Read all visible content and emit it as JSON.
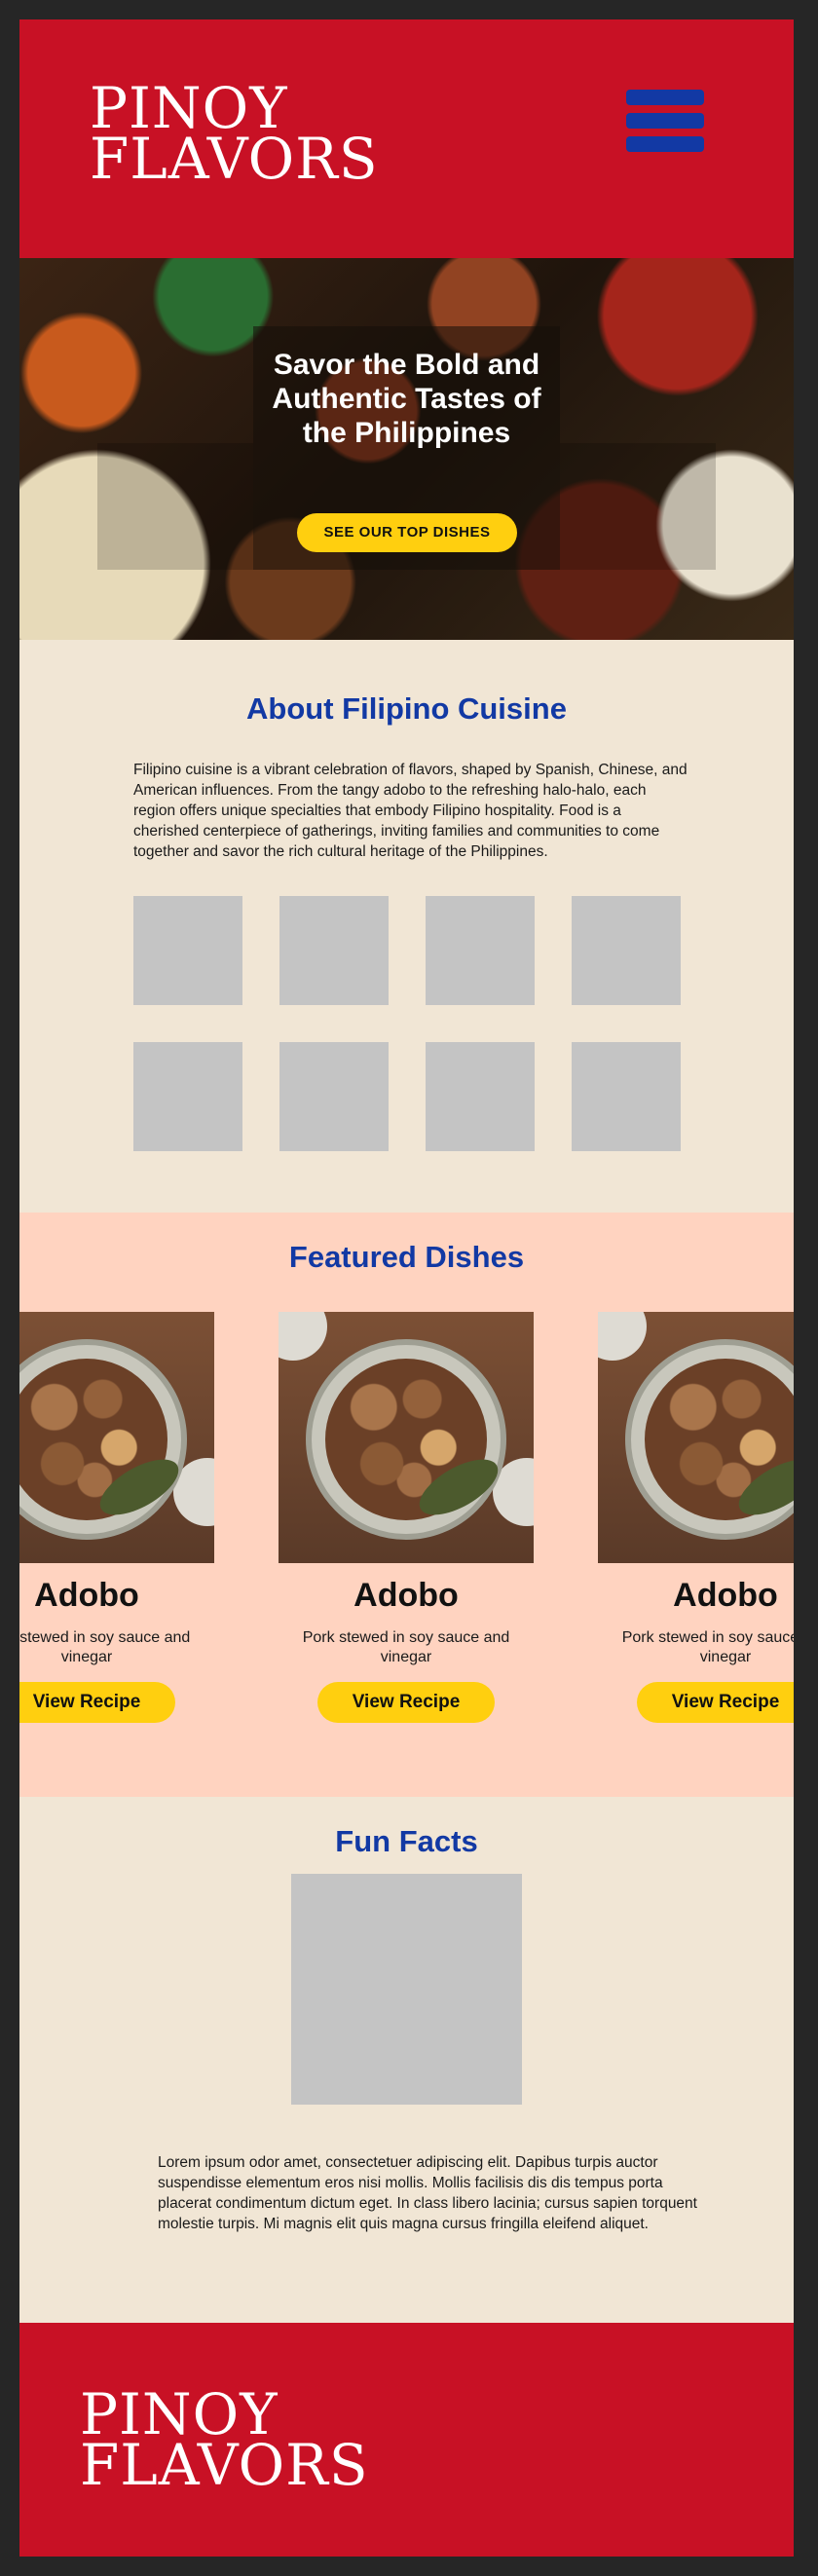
{
  "header": {
    "logo_line1": "PINOY",
    "logo_line2": "FLAVORS",
    "menu_icon": "hamburger-menu-icon"
  },
  "hero": {
    "title": "Savor the Bold and Authentic Tastes of the Philippines",
    "cta_label": "SEE OUR TOP DISHES"
  },
  "about": {
    "title": "About Filipino Cuisine",
    "text": "Filipino cuisine is a vibrant celebration of flavors, shaped by Spanish, Chinese, and American influences. From the tangy adobo to the refreshing halo-halo, each region offers unique specialties that embody Filipino hospitality. Food is a cherished centerpiece of gatherings, inviting families and communities to come together and savor the rich cultural heritage of the Philippines."
  },
  "featured": {
    "title": "Featured Dishes",
    "cards": [
      {
        "name": "Adobo",
        "desc": "Pork stewed in soy sauce and vinegar",
        "button": "View Recipe"
      },
      {
        "name": "Adobo",
        "desc": "Pork stewed in soy sauce and vinegar",
        "button": "View Recipe"
      },
      {
        "name": "Adobo",
        "desc": "Pork stewed in soy sauce and vinegar",
        "button": "View Recipe"
      }
    ]
  },
  "fun_facts": {
    "title": "Fun Facts",
    "text": "Lorem ipsum odor amet, consectetuer adipiscing elit. Dapibus turpis auctor suspendisse elementum eros nisi mollis. Mollis facilisis dis dis tempus porta placerat condimentum dictum eget. In class libero lacinia; cursus sapien torquent molestie turpis. Mi magnis elit quis magna cursus fringilla eleifend aliquet."
  },
  "footer": {
    "logo_line1": "PINOY",
    "logo_line2": "FLAVORS"
  },
  "colors": {
    "brand_red": "#c81125",
    "accent_blue": "#1239a4",
    "button_yellow": "#ffcf0f",
    "cream_bg": "#f1e6d5",
    "featured_bg": "#ffd3c0"
  }
}
